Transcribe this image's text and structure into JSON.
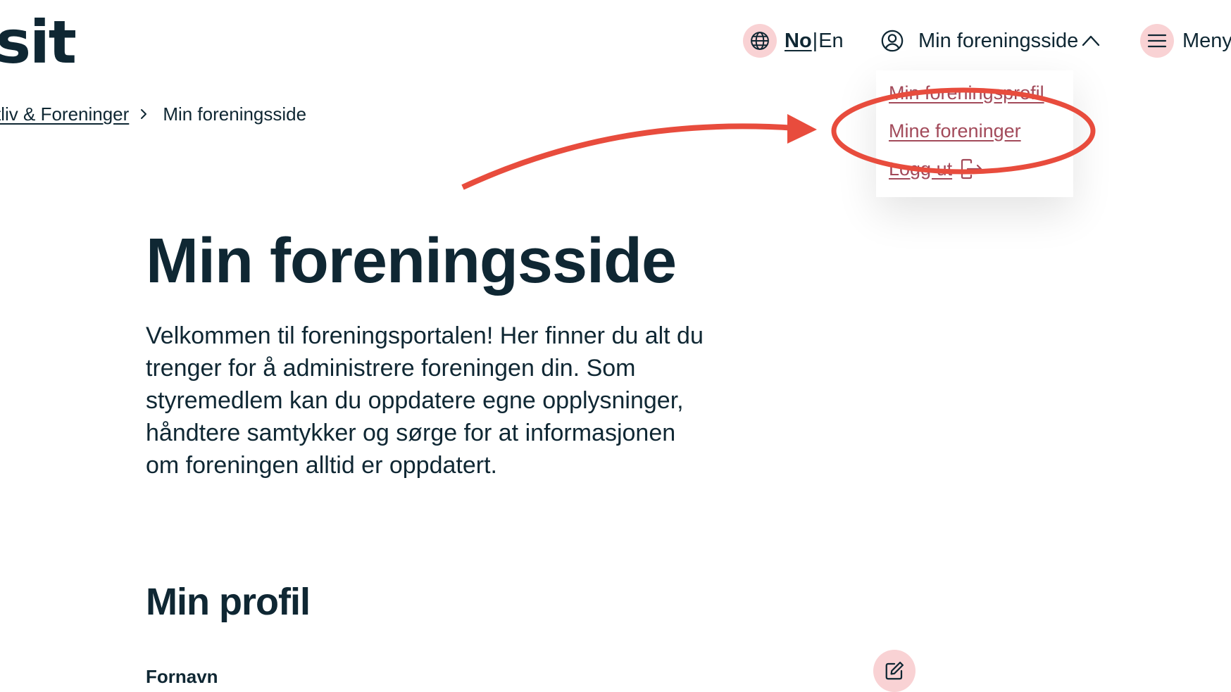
{
  "header": {
    "logo_text": "sit",
    "language": {
      "icon": "globe-icon",
      "current": "No",
      "separator": "|",
      "other": "En"
    },
    "account": {
      "icon": "user-circle-icon",
      "label": "Min foreningsside",
      "chevron_icon": "chevron-up-icon",
      "expanded": true
    },
    "menu": {
      "icon": "hamburger-icon",
      "label": "Meny"
    }
  },
  "account_dropdown": {
    "items": [
      {
        "label": "Min foreningsprofil"
      },
      {
        "label": "Mine foreninger"
      },
      {
        "label": "Logg ut",
        "icon": "logout-icon"
      }
    ]
  },
  "breadcrumb": {
    "items": [
      {
        "label": "tliv & Foreninger",
        "is_link": true
      },
      {
        "label": "Min foreningsside",
        "is_link": false
      }
    ],
    "separator_icon": "chevron-right-icon"
  },
  "main": {
    "title": "Min foreningsside",
    "intro": "Velkommen til foreningsportalen! Her finner du alt du trenger for å administrere foreningen din. Som styremedlem kan du oppdatere egne opplysninger, håndtere samtykker og sørge for at informasjonen om foreningen alltid er oppdatert.",
    "profile_section": {
      "title": "Min profil",
      "first_field_label": "Fornavn",
      "edit_icon": "edit-icon"
    }
  },
  "annotation": {
    "highlight_target": "Mine foreninger",
    "arrow_color": "#e84c3d",
    "circle_color": "#e84c3d"
  },
  "colors": {
    "primary_text": "#0f2733",
    "link_accent": "#a24a5a",
    "icon_bg": "#f9d2d4",
    "annotation": "#e84c3d"
  }
}
